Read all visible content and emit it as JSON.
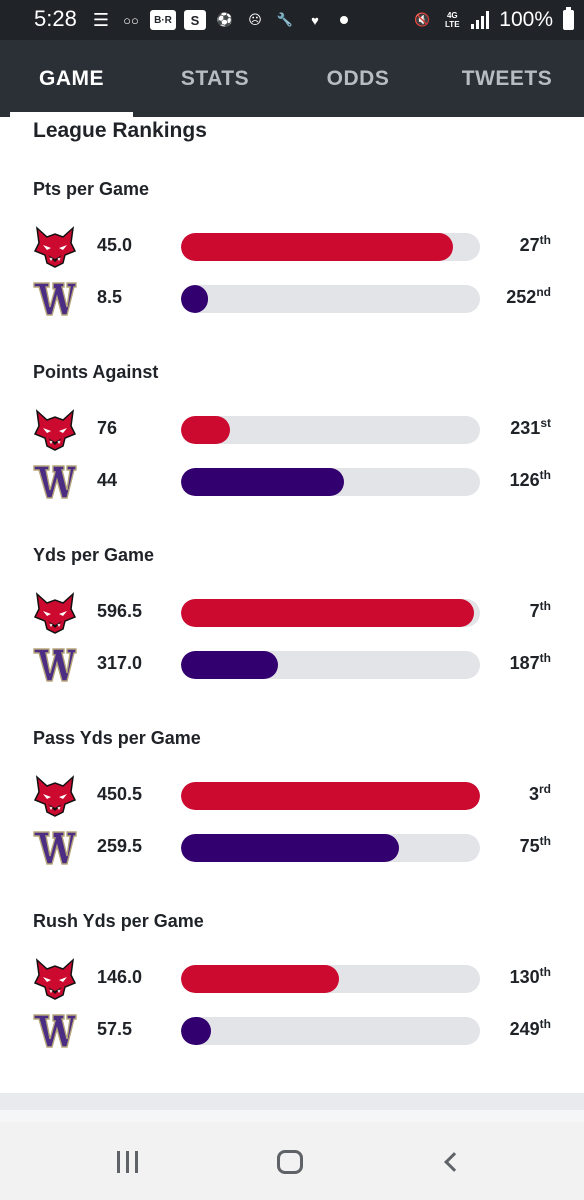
{
  "status_bar": {
    "time": "5:28",
    "left_icons": [
      "E",
      "oo",
      "B/R",
      "S",
      "ball",
      "mask",
      "wrench",
      "heart"
    ],
    "battery_text": "100%",
    "network": "4G LTE"
  },
  "tabs": [
    {
      "label": "GAME",
      "active": true
    },
    {
      "label": "STATS",
      "active": false
    },
    {
      "label": "ODDS",
      "active": false
    },
    {
      "label": "TWEETS",
      "active": false
    }
  ],
  "card": {
    "title": "League Rankings",
    "sections": [
      {
        "title": "Pts per Game",
        "rows": [
          {
            "team": "red-wolves-logo",
            "value": "45.0",
            "fill": 0.91,
            "color": "#cc0a30",
            "rank": "27",
            "suffix": "th"
          },
          {
            "team": "washington-logo",
            "value": "8.5",
            "fill": 0.09,
            "color": "#33006f",
            "rank": "252",
            "suffix": "nd"
          }
        ]
      },
      {
        "title": "Points Against",
        "rows": [
          {
            "team": "red-wolves-logo",
            "value": "76",
            "fill": 0.165,
            "color": "#cc0a30",
            "rank": "231",
            "suffix": "st"
          },
          {
            "team": "washington-logo",
            "value": "44",
            "fill": 0.545,
            "color": "#33006f",
            "rank": "126",
            "suffix": "th"
          }
        ]
      },
      {
        "title": "Yds per Game",
        "rows": [
          {
            "team": "red-wolves-logo",
            "value": "596.5",
            "fill": 0.98,
            "color": "#cc0a30",
            "rank": "7",
            "suffix": "th"
          },
          {
            "team": "washington-logo",
            "value": "317.0",
            "fill": 0.325,
            "color": "#33006f",
            "rank": "187",
            "suffix": "th"
          }
        ]
      },
      {
        "title": "Pass Yds per Game",
        "rows": [
          {
            "team": "red-wolves-logo",
            "value": "450.5",
            "fill": 1.0,
            "color": "#cc0a30",
            "rank": "3",
            "suffix": "rd"
          },
          {
            "team": "washington-logo",
            "value": "259.5",
            "fill": 0.73,
            "color": "#33006f",
            "rank": "75",
            "suffix": "th"
          }
        ]
      },
      {
        "title": "Rush Yds per Game",
        "rows": [
          {
            "team": "red-wolves-logo",
            "value": "146.0",
            "fill": 0.53,
            "color": "#cc0a30",
            "rank": "130",
            "suffix": "th"
          },
          {
            "team": "washington-logo",
            "value": "57.5",
            "fill": 0.1,
            "color": "#33006f",
            "rank": "249",
            "suffix": "th"
          }
        ]
      }
    ]
  }
}
